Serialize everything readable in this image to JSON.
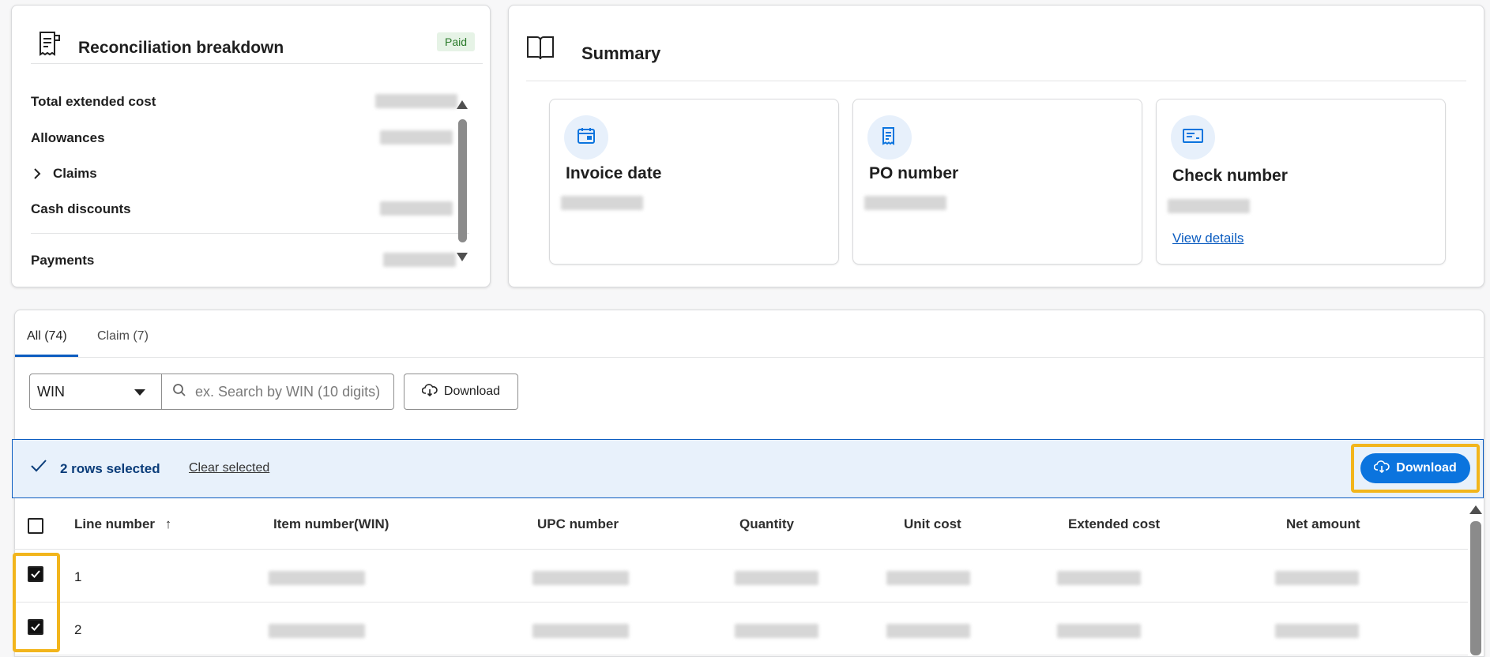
{
  "reconciliation": {
    "title": "Reconciliation breakdown",
    "status": "Paid",
    "rows": [
      {
        "label": "Total extended cost"
      },
      {
        "label": "Allowances"
      },
      {
        "label": "Claims"
      },
      {
        "label": "Cash discounts"
      },
      {
        "label": "Payments"
      }
    ]
  },
  "summary": {
    "title": "Summary",
    "cards": [
      {
        "label": "Invoice date",
        "icon": "calendar-icon"
      },
      {
        "label": "PO number",
        "icon": "document-icon"
      },
      {
        "label": "Check number",
        "icon": "check-icon",
        "link": "View details"
      }
    ]
  },
  "tabs": [
    {
      "label": "All (74)",
      "active": true
    },
    {
      "label": "Claim (7)",
      "active": false
    }
  ],
  "filter": {
    "select_value": "WIN",
    "search_placeholder": "ex. Search by WIN (10 digits)",
    "download_label": "Download"
  },
  "selection": {
    "text": "2 rows selected",
    "clear_label": "Clear selected",
    "download_label": "Download"
  },
  "table": {
    "columns": [
      "Line number",
      "Item number(WIN)",
      "UPC number",
      "Quantity",
      "Unit cost",
      "Extended cost",
      "Net amount"
    ],
    "sort_indicator": "↑",
    "rows": [
      {
        "line": "1",
        "checked": true
      },
      {
        "line": "2",
        "checked": true
      }
    ]
  },
  "colors": {
    "accent": "#0b74de",
    "link": "#0b5cc0",
    "highlight": "#f2b51c",
    "paid_bg": "#e6f3e6"
  }
}
